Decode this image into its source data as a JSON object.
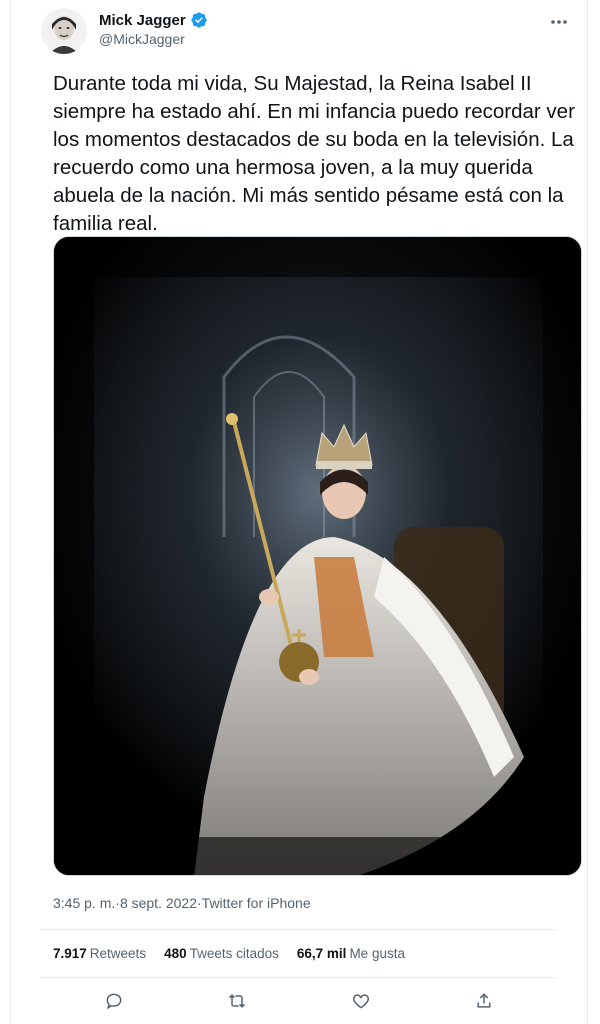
{
  "author": {
    "name": "Mick Jagger",
    "handle": "@MickJagger",
    "verified": true
  },
  "tweet": {
    "text": "Durante toda mi vida, Su Majestad, la Reina Isabel II siempre ha estado ahí. En mi infancia puedo recordar ver los momentos destacados de su boda en la televisión. La recuerdo como una hermosa joven, a la muy querida abuela de la nación. Mi más sentido pésame está con la familia real."
  },
  "meta": {
    "time": "3:45 p. m.",
    "separator": " · ",
    "date": "8 sept. 2022",
    "source": "Twitter for iPhone"
  },
  "stats": {
    "retweets_count": "7.917",
    "retweets_label": "Retweets",
    "quotes_count": "480",
    "quotes_label": "Tweets citados",
    "likes_count": "66,7 mil",
    "likes_label": "Me gusta"
  },
  "colors": {
    "verified": "#1d9bf0",
    "text": "#0f1419",
    "secondary": "#536471"
  },
  "icons": [
    "more-icon",
    "reply-icon",
    "retweet-icon",
    "like-icon",
    "share-icon",
    "verified-badge-icon"
  ]
}
